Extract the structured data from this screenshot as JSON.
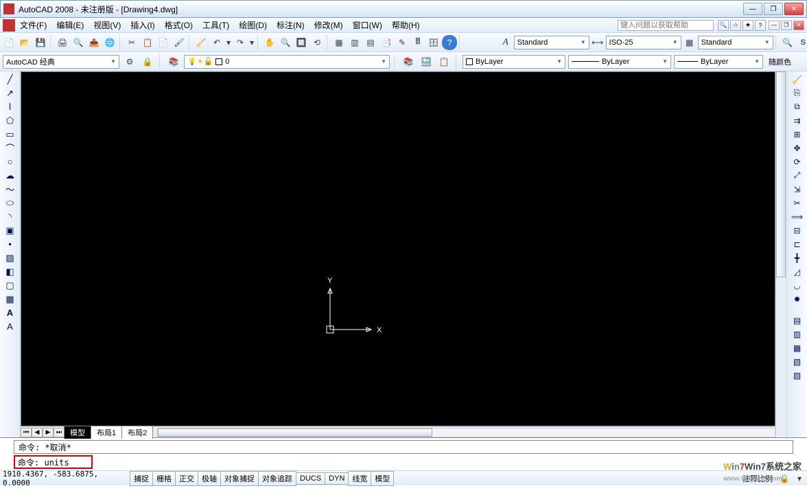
{
  "title": "AutoCAD 2008 - 未注册版 - [Drawing4.dwg]",
  "menu": [
    "文件(F)",
    "编辑(E)",
    "视图(V)",
    "插入(I)",
    "格式(O)",
    "工具(T)",
    "绘图(D)",
    "标注(N)",
    "修改(M)",
    "窗口(W)",
    "帮助(H)"
  ],
  "help_placeholder": "键入问题以获取帮助",
  "toolbar1_icons": [
    "new",
    "open",
    "save",
    "print",
    "plot-preview",
    "publish",
    "cut",
    "copy",
    "paste",
    "match",
    "undo",
    "redo",
    "pan",
    "zoom-rt",
    "zoom-win",
    "zoom-prev",
    "properties",
    "dsv",
    "dc",
    "tool-palettes",
    "sheet",
    "markup",
    "calc",
    "help"
  ],
  "style_text": {
    "label": "Standard"
  },
  "dim_style": {
    "label": "ISO-25"
  },
  "table_style": {
    "label": "Standard"
  },
  "workspace": {
    "label": "AutoCAD 经典"
  },
  "layer": {
    "current": "0"
  },
  "bylayer": "ByLayer",
  "bycolor_label": "随颜色",
  "tabs": {
    "model": "模型",
    "layout1": "布局1",
    "layout2": "布局2"
  },
  "cmd_hist": "命令: *取消*",
  "cmd_prompt": "命令: units",
  "ucs_labels": {
    "x": "X",
    "y": "Y"
  },
  "coords": "1910.4367, -583.6875, 0.0000",
  "status_btns": [
    "捕捉",
    "栅格",
    "正交",
    "极轴",
    "对象捕捉",
    "对象追踪",
    "DUCS",
    "DYN",
    "线宽",
    "模型"
  ],
  "scale_label": "注释比例",
  "left_tools": [
    "line",
    "xline",
    "pline",
    "polygon",
    "rect",
    "arc",
    "circle",
    "revcloud",
    "spline",
    "ellipse",
    "ellipse-arc",
    "block",
    "point",
    "hatch",
    "gradient",
    "region",
    "table",
    "mtext",
    "text"
  ],
  "right_tools": [
    "erase",
    "copy",
    "mirror",
    "offset",
    "array",
    "move",
    "rotate",
    "scale",
    "stretch",
    "trim",
    "extend",
    "break-pt",
    "break",
    "join",
    "chamfer",
    "fillet",
    "explode"
  ],
  "watermark": {
    "brand": "Win7系统之家",
    "url": "www.WTwin7.com"
  }
}
